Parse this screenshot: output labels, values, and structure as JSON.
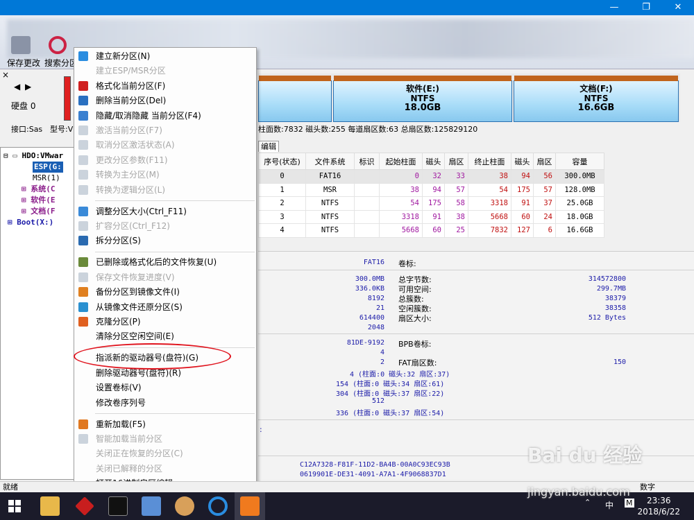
{
  "window": {
    "minimize": "—",
    "maximize": "❐",
    "close": "✕"
  },
  "toolbar": {
    "save_label": "保存更改",
    "search_label": "搜索分区"
  },
  "diskinfo": {
    "close_x": "×",
    "disk_label": "硬盘 0",
    "interface_label": "接口:Sas",
    "model_label": "型号:V"
  },
  "tree": {
    "root": "HDO:VMwar",
    "items": [
      "ESP(G:",
      "MSR(1)",
      "系统(C",
      "软件(E",
      "文档(F"
    ],
    "boot": "Boot(X:)"
  },
  "partitions": [
    {
      "name": "软件(E:)",
      "fs": "NTFS",
      "size": "18.0GB"
    },
    {
      "name": "文档(F:)",
      "fs": "NTFS",
      "size": "16.6GB"
    }
  ],
  "diskstatus": "柱面数:7832  磁头数:255  每道扇区数:63  总扇区数:125829120",
  "tab_label": "编辑",
  "table": {
    "headers": [
      "序号(状态)",
      "文件系统",
      "标识",
      "起始柱面",
      "磁头",
      "扇区",
      "终止柱面",
      "磁头",
      "扇区",
      "容量"
    ],
    "rows": [
      [
        "0",
        "FAT16",
        "",
        "0",
        "32",
        "33",
        "38",
        "94",
        "56",
        "300.0MB"
      ],
      [
        "1",
        "MSR",
        "",
        "38",
        "94",
        "57",
        "54",
        "175",
        "57",
        "128.0MB"
      ],
      [
        "2",
        "NTFS",
        "",
        "54",
        "175",
        "58",
        "3318",
        "91",
        "37",
        "25.0GB"
      ],
      [
        "3",
        "NTFS",
        "",
        "3318",
        "91",
        "38",
        "5668",
        "60",
        "24",
        "18.0GB"
      ],
      [
        "4",
        "NTFS",
        "",
        "5668",
        "60",
        "25",
        "7832",
        "127",
        "6",
        "16.6GB"
      ]
    ]
  },
  "details": {
    "fs": "FAT16",
    "volume_label": "卷标:",
    "left_values": [
      "300.0MB",
      "336.0KB",
      "8192",
      "21",
      "614400",
      "2048"
    ],
    "right_labels": [
      "总字节数:",
      "可用空间:",
      "总簇数:",
      "空闲簇数:",
      "扇区大小:"
    ],
    "right_values": [
      "314572800",
      "299.7MB",
      "38379",
      "38358",
      "512 Bytes"
    ],
    "serial": "81DE-9192",
    "bpb_label": "BPB卷标:",
    "v4": "4",
    "v2": "2",
    "fat_label": "FAT扇区数:",
    "fat_value": "150",
    "chs_lines": [
      "4 (柱面:0 磁头:32 扇区:37)",
      "154 (柱面:0 磁头:34 扇区:61)",
      "304 (柱面:0 磁头:37 扇区:22)",
      "512",
      "336 (柱面:0 磁头:37 扇区:54)"
    ],
    "colon": ":",
    "guid1": "C12A7328-F81F-11D2-BA4B-00A0C93EC93B",
    "guid2": "0619901E-DE31-4091-A7A1-4F9068837D1"
  },
  "menu": [
    {
      "label": "建立新分区(N)",
      "disabled": false
    },
    {
      "label": "建立ESP/MSR分区",
      "disabled": true
    },
    {
      "label": "格式化当前分区(F)",
      "disabled": false
    },
    {
      "label": "删除当前分区(Del)",
      "disabled": false
    },
    {
      "label": "隐藏/取消隐藏 当前分区(F4)",
      "disabled": false
    },
    {
      "label": "激活当前分区(F7)",
      "disabled": true
    },
    {
      "label": "取消分区激活状态(A)",
      "disabled": true
    },
    {
      "label": "更改分区参数(F11)",
      "disabled": true
    },
    {
      "label": "转换为主分区(M)",
      "disabled": true
    },
    {
      "label": "转换为逻辑分区(L)",
      "disabled": true
    },
    {
      "label": "调整分区大小(Ctrl_F11)",
      "disabled": false
    },
    {
      "label": "扩容分区(Ctrl_F12)",
      "disabled": true
    },
    {
      "label": "拆分分区(S)",
      "disabled": false
    },
    {
      "label": "已删除或格式化后的文件恢复(U)",
      "disabled": false
    },
    {
      "label": "保存文件恢复进度(V)",
      "disabled": true
    },
    {
      "label": "备份分区到镜像文件(I)",
      "disabled": false
    },
    {
      "label": "从镜像文件还原分区(S)",
      "disabled": false
    },
    {
      "label": "克隆分区(P)",
      "disabled": false
    },
    {
      "label": "清除分区空闲空间(E)",
      "disabled": false
    },
    {
      "label": "指派新的驱动器号(盘符)(G)",
      "disabled": false
    },
    {
      "label": "删除驱动器号(盘符)(R)",
      "disabled": false
    },
    {
      "label": "设置卷标(V)",
      "disabled": false
    },
    {
      "label": "修改卷序列号",
      "disabled": false
    },
    {
      "label": "重新加载(F5)",
      "disabled": false
    },
    {
      "label": "智能加载当前分区",
      "disabled": true
    },
    {
      "label": "关闭正在恢复的分区(C)",
      "disabled": true
    },
    {
      "label": "关闭已解释的分区",
      "disabled": true
    },
    {
      "label": "打开16进制扇区编辑",
      "disabled": false
    }
  ],
  "statusbar": {
    "left": "就绪",
    "right": "数字"
  },
  "taskbar": {
    "time": "23:36",
    "date": "2018/6/22",
    "ime": "中",
    "m": "M"
  },
  "watermark": {
    "brand": "Bai du 经验",
    "url": "jingyan.baidu.com"
  },
  "colors": {
    "titlebar": "#0078d7",
    "highlight_oval": "#e0141e",
    "value_blue": "#1a1aa8",
    "cyl_purple": "#a018a0",
    "cyl_red": "#c01010"
  }
}
